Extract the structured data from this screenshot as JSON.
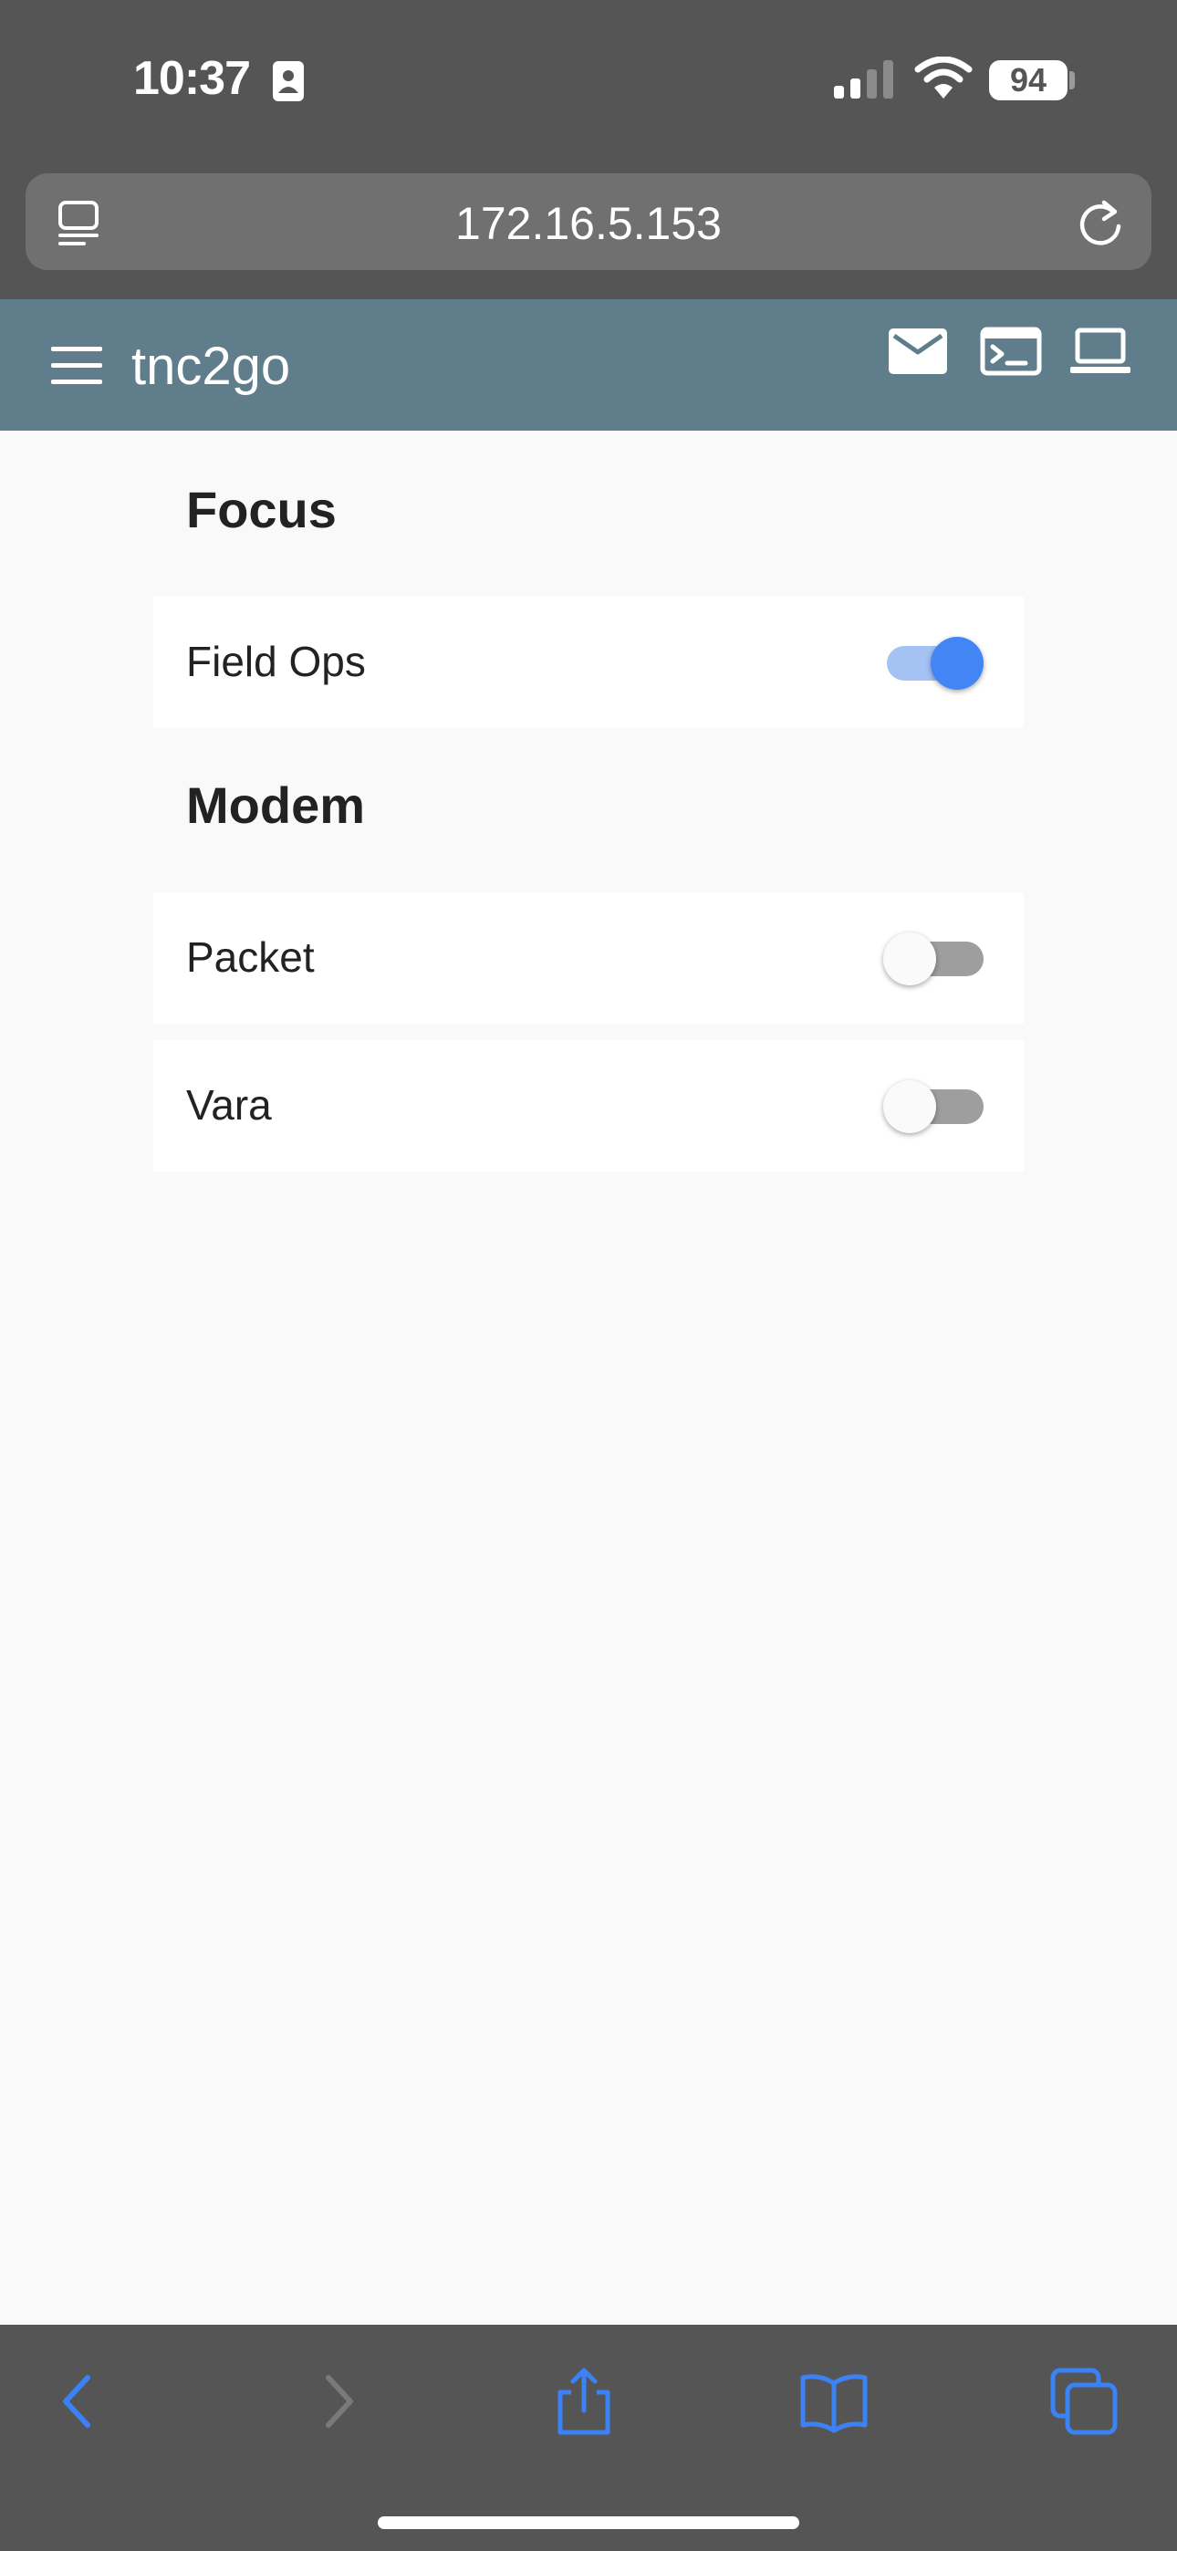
{
  "status_bar": {
    "time": "10:37",
    "battery": "94"
  },
  "browser": {
    "url": "172.16.5.153"
  },
  "app": {
    "title": "tnc2go",
    "header_color": "#607d8b"
  },
  "sections": [
    {
      "title": "Focus",
      "items": [
        {
          "label": "Field Ops",
          "enabled": true
        }
      ]
    },
    {
      "title": "Modem",
      "items": [
        {
          "label": "Packet",
          "enabled": false
        },
        {
          "label": "Vara",
          "enabled": false
        }
      ]
    }
  ],
  "colors": {
    "toggle_on": "#4285f4",
    "toggle_on_track": "#a4c2f4",
    "toggle_off_track": "#9e9e9e",
    "toolbar_accent": "#3b82f6"
  },
  "icons": {
    "header": [
      "mail-icon",
      "terminal-icon",
      "laptop-icon"
    ],
    "toolbar": [
      "back-icon",
      "forward-icon",
      "share-icon",
      "bookmarks-icon",
      "tabs-icon"
    ]
  }
}
